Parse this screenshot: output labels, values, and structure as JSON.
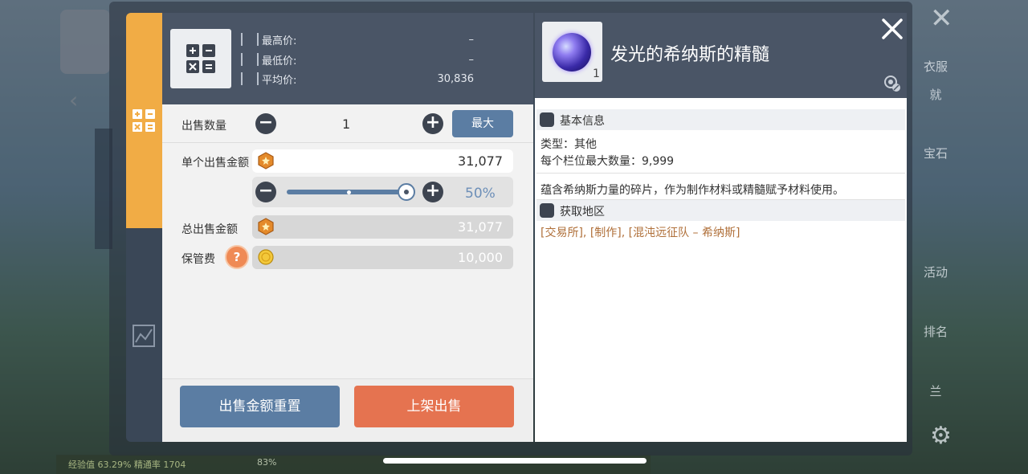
{
  "price_info": {
    "high_label": "最高价:",
    "high_value": "–",
    "low_label": "最低价:",
    "low_value": "–",
    "avg_label": "平均价:",
    "avg_value": "30,836"
  },
  "sell_form": {
    "qty_label": "出售数量",
    "qty_value": "1",
    "max_label": "最大",
    "unit_price_label": "单个出售金额",
    "unit_price_value": "31,077",
    "slider_percent_text": "50%",
    "slider_percent": 50,
    "total_label": "总出售金额",
    "total_value": "31,077",
    "fee_label": "保管费",
    "fee_value": "10,000",
    "help_symbol": "?"
  },
  "buttons": {
    "reset_label": "出售金额重置",
    "sell_label": "上架出售"
  },
  "item": {
    "name": "发光的希纳斯的精髓",
    "count": "1",
    "basic_info_header": "基本信息",
    "type_text": "类型：其他",
    "max_stack_text": "每个栏位最大数量：9,999",
    "description": "蕴含希纳斯力量的碎片，作为制作材料或精髓赋予材料使用。",
    "source_header": "获取地区",
    "source_text": "[交易所], [制作], [混沌远征队 – 希纳斯]"
  },
  "background": {
    "status_left": "经验值 63.29%  精通率 1704",
    "battery": "83%",
    "right_labels": [
      "衣服",
      "就",
      "宝石",
      "活动",
      "排名",
      "兰"
    ]
  },
  "colors": {
    "accent_blue": "#5b7da3",
    "sell_orange": "#e57350",
    "tab_orange": "#f1ac45",
    "header_slate": "#4a5566",
    "source_brown": "#b0703a"
  },
  "icons": {
    "calculator": "calculator-icon",
    "chart": "chart-icon",
    "minus": "minus-icon",
    "plus": "plus-icon",
    "coin_hex": "hex-coin-icon",
    "coin_gold": "gold-coin-icon",
    "close": "close-icon",
    "lock": "lock-icon",
    "info": "info-bag-icon",
    "location": "location-pin-icon"
  }
}
